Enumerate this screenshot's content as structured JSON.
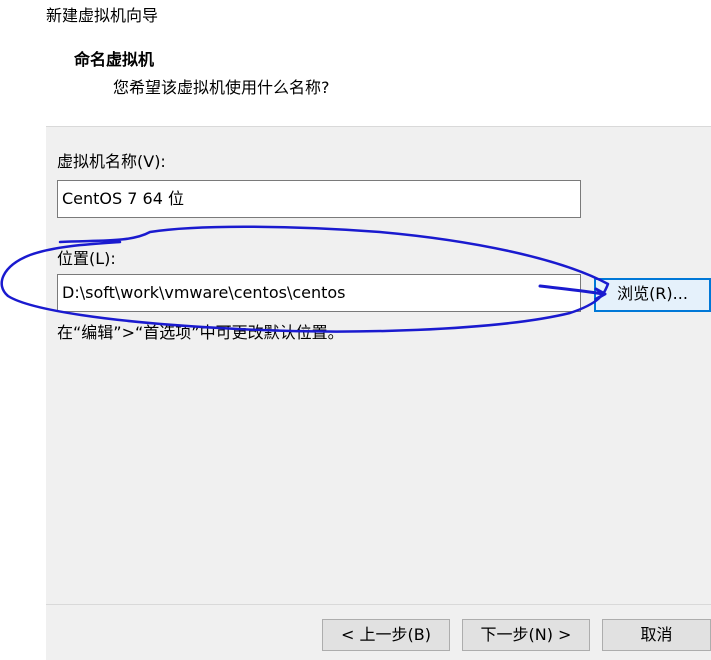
{
  "window": {
    "title": "新建虚拟机向导"
  },
  "header": {
    "title": "命名虚拟机",
    "subtitle": "您希望该虚拟机使用什么名称?"
  },
  "form": {
    "name_label": "虚拟机名称(V):",
    "name_value": "CentOS 7 64 位",
    "location_label": "位置(L):",
    "location_value": "D:\\soft\\work\\vmware\\centos\\centos",
    "browse_label": "浏览(R)...",
    "hint": "在“编辑”>“首选项”中可更改默认位置。"
  },
  "footer": {
    "back_label": "< 上一步(B)",
    "next_label": "下一步(N) >",
    "cancel_label": "取消"
  },
  "colors": {
    "annotation_stroke": "#1a1acf",
    "focus_border": "#0078d7"
  }
}
